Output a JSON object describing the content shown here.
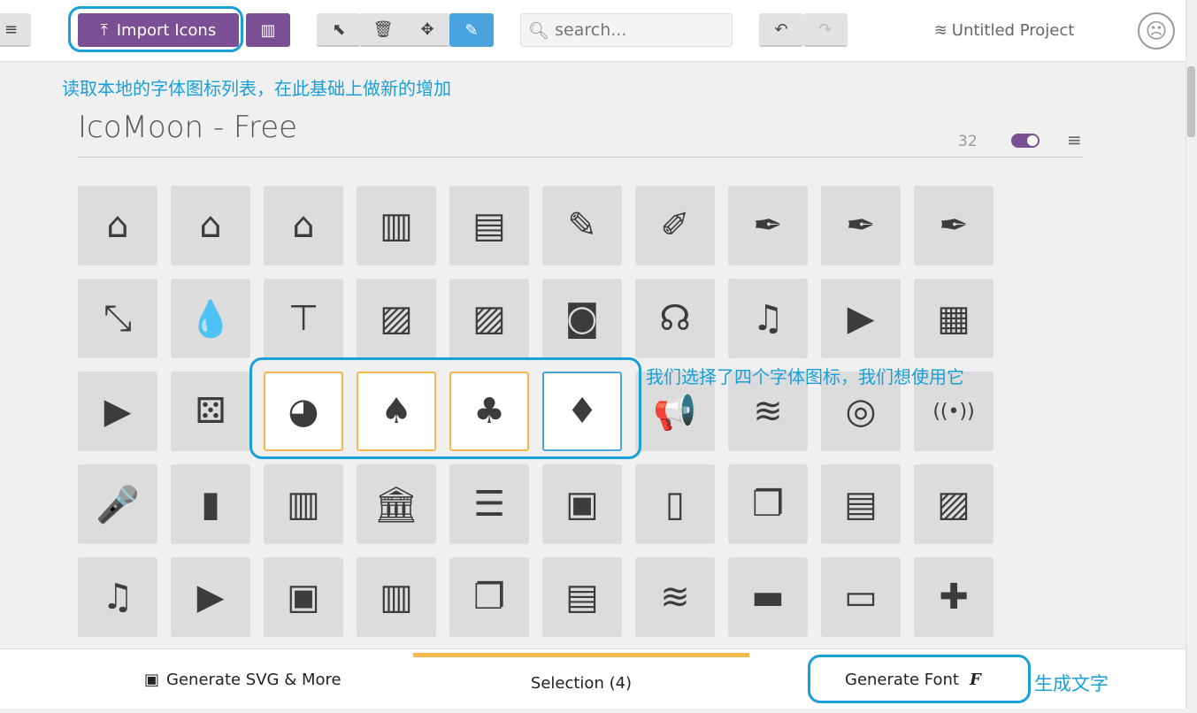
{
  "toolbar": {
    "import_label": "Import Icons",
    "search_placeholder": "search...",
    "project": "Untitled Project"
  },
  "notes": {
    "import": "读取本地的字体图标列表，在此基础上做新的增加",
    "selection": "我们选择了四个字体图标，我们想使用它",
    "generate": "生成文字"
  },
  "set": {
    "title": "IcoMoon - Free",
    "count": "32"
  },
  "colors": {
    "accent": "#7b4f93",
    "highlight": "#1a9fd9",
    "selected": "#f7b84b",
    "active": "#4aa3df"
  },
  "icons": [
    [
      "home",
      "⌂"
    ],
    [
      "home2",
      "⌂"
    ],
    [
      "home3",
      "⌂"
    ],
    [
      "office",
      "▥"
    ],
    [
      "newspaper",
      "▤"
    ],
    [
      "pencil",
      "✎"
    ],
    [
      "pencil2",
      "✐"
    ],
    [
      "quill",
      "✒"
    ],
    [
      "pen",
      "✒"
    ],
    [
      "blog",
      "✒"
    ],
    [
      "eyedropper",
      "⤡"
    ],
    [
      "droplet",
      "💧"
    ],
    [
      "paint-format",
      "⊤"
    ],
    [
      "image",
      "▨"
    ],
    [
      "images",
      "▨"
    ],
    [
      "camera",
      "◙"
    ],
    [
      "headphones",
      "☊"
    ],
    [
      "music",
      "♫"
    ],
    [
      "play",
      "▶"
    ],
    [
      "film",
      "▦"
    ],
    [
      "video-camera",
      "▶"
    ],
    [
      "dice",
      "⚄"
    ],
    [
      "pacman",
      "◕"
    ],
    [
      "spades",
      "♠"
    ],
    [
      "clubs",
      "♣"
    ],
    [
      "diamonds",
      "♦"
    ],
    [
      "bullhorn",
      "📢"
    ],
    [
      "connection",
      "≋"
    ],
    [
      "podcast",
      "◎"
    ],
    [
      "feed",
      "((•))"
    ],
    [
      "mic",
      "🎤"
    ],
    [
      "book",
      "▮"
    ],
    [
      "books",
      "▥"
    ],
    [
      "library",
      "🏛"
    ],
    [
      "file-text",
      "☰"
    ],
    [
      "profile",
      "▣"
    ],
    [
      "file-empty",
      "▯"
    ],
    [
      "files-empty",
      "❐"
    ],
    [
      "file-text2",
      "▤"
    ],
    [
      "file-picture",
      "▨"
    ],
    [
      "file-music",
      "♫"
    ],
    [
      "file-play",
      "▶"
    ],
    [
      "file-video",
      "▣"
    ],
    [
      "file-zip",
      "▥"
    ],
    [
      "copy",
      "❐"
    ],
    [
      "paste",
      "▤"
    ],
    [
      "stack",
      "≋"
    ],
    [
      "folder",
      "▬"
    ],
    [
      "folder-open",
      "▭"
    ],
    [
      "folder-plus",
      "✚"
    ]
  ],
  "selected": [
    "pacman",
    "spades",
    "clubs",
    "diamonds"
  ],
  "bottom": {
    "svg": "Generate SVG & More",
    "selection": "Selection (4)",
    "font": "Generate Font"
  }
}
